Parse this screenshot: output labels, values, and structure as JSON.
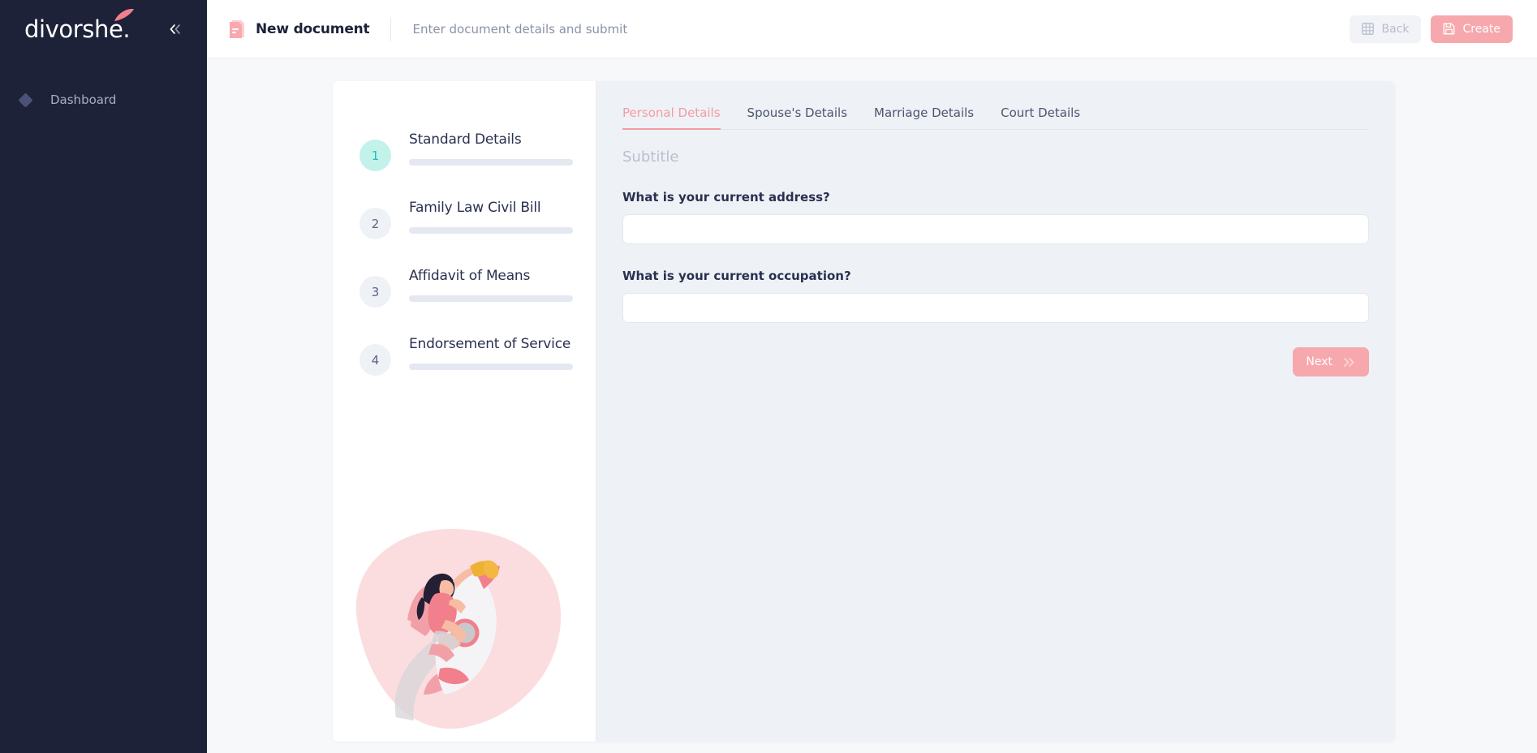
{
  "brand": {
    "name": "divorshe.",
    "collapse_icon": "chevron-double-left-icon"
  },
  "sidebar": {
    "items": [
      {
        "label": "Dashboard",
        "icon": "diamond-icon"
      }
    ]
  },
  "topbar": {
    "doc_icon": "document-icon",
    "title": "New document",
    "subtitle": "Enter document details and submit",
    "back_label": "Back",
    "back_icon": "grid-icon",
    "create_label": "Create",
    "create_icon": "save-icon"
  },
  "steps": [
    {
      "number": "1",
      "title": "Standard Details",
      "active": true
    },
    {
      "number": "2",
      "title": "Family Law Civil Bill",
      "active": false
    },
    {
      "number": "3",
      "title": "Affidavit of Means",
      "active": false
    },
    {
      "number": "4",
      "title": "Endorsement of Service",
      "active": false
    }
  ],
  "illustration": {
    "name": "woman-on-rocket-with-megaphone-illustration"
  },
  "form": {
    "tabs": [
      {
        "label": "Personal Details",
        "active": true
      },
      {
        "label": "Spouse's Details",
        "active": false
      },
      {
        "label": "Marriage Details",
        "active": false
      },
      {
        "label": "Court Details",
        "active": false
      }
    ],
    "subtitle": "Subtitle",
    "fields": [
      {
        "label": "What is your current address?",
        "value": "",
        "placeholder": ""
      },
      {
        "label": "What is your current occupation?",
        "value": "",
        "placeholder": ""
      }
    ],
    "next_label": "Next",
    "next_icon": "chevron-double-right-icon"
  },
  "colors": {
    "sidebar_bg": "#1d2238",
    "accent_pink": "#f7a8ad",
    "accent_mint": "#c3f2ea",
    "accent_teal": "#25bfae",
    "panel_bg": "#eef2f6"
  }
}
